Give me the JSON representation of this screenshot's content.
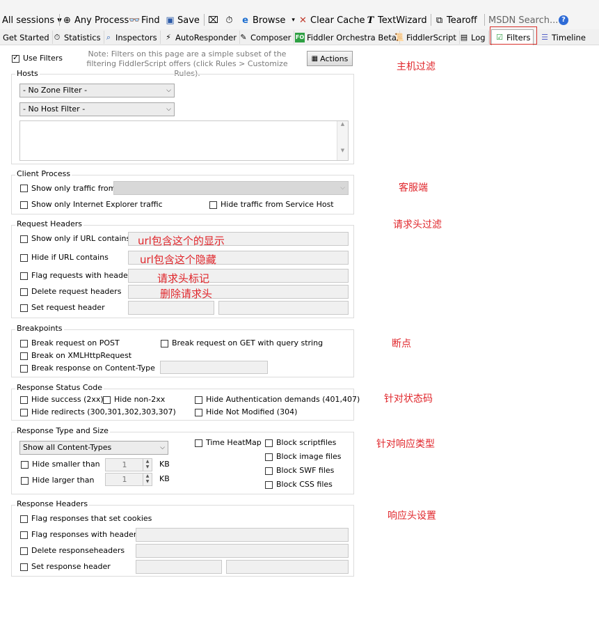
{
  "toolbar": {
    "sessions": "All sessions ▾",
    "any_process": "Any Process",
    "find": "Find",
    "save": "Save",
    "browse": "Browse",
    "clear_cache": "Clear Cache",
    "textwizard": "TextWizard",
    "tearoff": "Tearoff",
    "msdn_search": "MSDN Search..."
  },
  "tabs": [
    {
      "label": "Get Started",
      "icon": "none"
    },
    {
      "label": "Statistics",
      "icon": "stopwatch-icon"
    },
    {
      "label": "Inspectors",
      "icon": "inspect-icon"
    },
    {
      "label": "AutoResponder",
      "icon": "lightning-icon"
    },
    {
      "label": "Composer",
      "icon": "pencil-icon"
    },
    {
      "label": "Fiddler Orchestra Beta",
      "icon": "fo-icon"
    },
    {
      "label": "FiddlerScript",
      "icon": "script-icon"
    },
    {
      "label": "Log",
      "icon": "log-icon"
    },
    {
      "label": "Filters",
      "icon": "checkbox-icon"
    },
    {
      "label": "Timeline",
      "icon": "timeline-icon"
    }
  ],
  "filters": {
    "use_filters": "Use Filters",
    "note": "Note: Filters on this page are a simple subset of the filtering FiddlerScript offers (click Rules > Customize Rules).",
    "actions": "Actions"
  },
  "hosts": {
    "title": "Hosts",
    "zone_filter": "- No Zone Filter -",
    "host_filter": "- No Host Filter -"
  },
  "client_process": {
    "title": "Client Process",
    "show_only_from": "Show only traffic from",
    "show_only_ie": "Show only Internet Explorer traffic",
    "hide_service_host": "Hide traffic from Service Host"
  },
  "request_headers": {
    "title": "Request Headers",
    "show_only_url": "Show only if URL contains",
    "hide_url": "Hide if URL contains",
    "flag_requests": "Flag requests with headers",
    "delete_headers": "Delete request headers",
    "set_header": "Set request header"
  },
  "breakpoints": {
    "title": "Breakpoints",
    "break_post": "Break request on POST",
    "break_get": "Break request on GET with query string",
    "break_xhr": "Break on XMLHttpRequest",
    "break_response_ct": "Break response on Content-Type"
  },
  "status_code": {
    "title": "Response Status Code",
    "hide_success": "Hide success (2xx)",
    "hide_non2xx": "Hide non-2xx",
    "hide_auth": "Hide Authentication demands (401,407)",
    "hide_redirects": "Hide redirects (300,301,302,303,307)",
    "hide_not_modified": "Hide Not Modified (304)"
  },
  "type_size": {
    "title": "Response Type and Size",
    "content_types": "Show all Content-Types",
    "time_heatmap": "Time HeatMap",
    "block_script": "Block scriptfiles",
    "block_image": "Block image files",
    "block_swf": "Block SWF files",
    "block_css": "Block CSS files",
    "hide_smaller": "Hide smaller than",
    "hide_larger": "Hide larger than",
    "smaller_value": "1",
    "larger_value": "1",
    "unit": "KB"
  },
  "response_headers": {
    "title": "Response Headers",
    "flag_cookies": "Flag responses that set cookies",
    "flag_headers": "Flag responses with headers",
    "delete_headers": "Delete responseheaders",
    "set_header": "Set response header"
  },
  "annotations": {
    "hosts": "主机过滤",
    "client": "客服端",
    "request_headers": "请求头过滤",
    "url_show": "url包含这个的显示",
    "url_hide": "url包含这个隐藏",
    "header_flag": "请求头标记",
    "header_delete": "删除请求头",
    "breakpoints": "断点",
    "status_code": "针对状态码",
    "response_type": "针对响应类型",
    "response_headers": "响应头设置"
  },
  "colors": {
    "annotation": "#e0262b",
    "highlight_border": "#d9302b"
  }
}
